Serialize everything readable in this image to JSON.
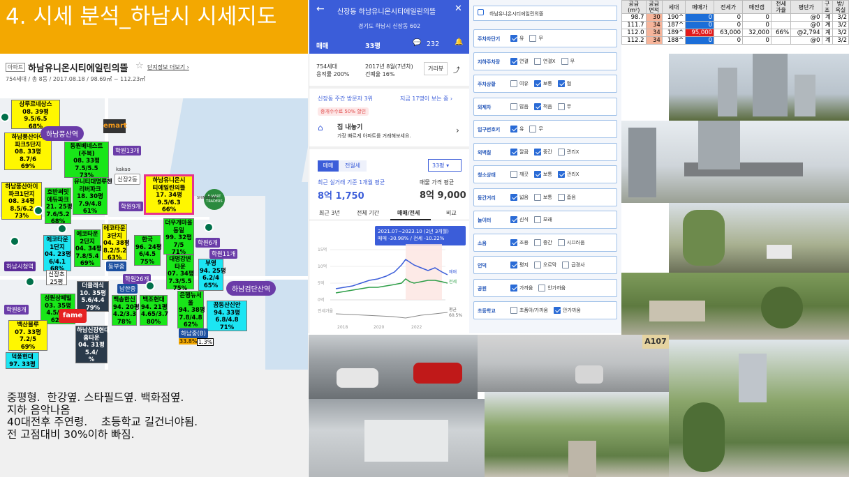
{
  "slide": {
    "title": "4. 시세 분석_하남시 시세지도"
  },
  "complex": {
    "badge": "아파트",
    "name": "하남유니온시티에일린의뜰",
    "link": "단지정보 더보기 ›",
    "meta": "754세대 / 총 8동 / 2017.08.18 / 98.69㎡ ~ 112.23㎡"
  },
  "map": {
    "places": [
      {
        "id": "p1",
        "text": "상루르네상스\n08. 39평\n9.5/6.5\n68%",
        "cls": "yel"
      },
      {
        "id": "p2",
        "text": "하남풍산아이\n파크5단지\n08. 33평\n8.7/6\n69%",
        "cls": "yel"
      },
      {
        "id": "p3",
        "text": "동원베네스트\n(주복)\n08. 33평\n7.5/5.5\n73%",
        "cls": "grn"
      },
      {
        "id": "p4",
        "text": "하남풍산아이\n파크1단지\n08. 34평\n8.5/6.2\n73%",
        "cls": "yel"
      },
      {
        "id": "p5",
        "text": "호반써밋\n에듀파크\n21. 25평\n7.6/5.2\n68%",
        "cls": "grn"
      },
      {
        "id": "p6",
        "text": "유니티대명루첸\n리버파크\n18. 30평\n7.9/4.8\n61%",
        "cls": "grn"
      },
      {
        "id": "p7",
        "text": "하남유니온시\n티에일린의뜰\n17. 34평\n9.5/6.3\n66%",
        "cls": "yel"
      },
      {
        "id": "p8",
        "text": "에코타운\n1단지\n04. 23평\n6/4.1\n68%",
        "cls": "cyn"
      },
      {
        "id": "p9",
        "text": "에코타운\n2단지\n04. 34평\n7.8/5.4\n69%",
        "cls": "grn"
      },
      {
        "id": "p10",
        "text": "에코타운\n3단지\n04. 38평\n8.2/5.2\n63%",
        "cls": "yel"
      },
      {
        "id": "p11",
        "text": "한국\n96. 24평\n6/4.5\n75%",
        "cls": "grn"
      },
      {
        "id": "p12",
        "text": "더우개마을\n동일\n99. 32평\n7/5\n71%",
        "cls": "grn"
      },
      {
        "id": "p13",
        "text": "대명강변\n타운\n07. 34평\n7.3/5.5\n75%",
        "cls": "grn"
      },
      {
        "id": "p14",
        "text": "부영\n94. 25평\n6.2/4\n65%",
        "cls": "cyn"
      },
      {
        "id": "p15",
        "text": "더클래식\n10. 35평\n5.6/4.4\n79%",
        "cls": "drk"
      },
      {
        "id": "p16",
        "text": "성원상떼빌\n03. 35평\n4.5/2.8\n62%",
        "cls": "grn"
      },
      {
        "id": "p17",
        "text": "백송한신\n94. 20평\n4.2/3.3\n78%",
        "cls": "grn"
      },
      {
        "id": "p18",
        "text": "백조현대\n94. 21평\n4.65/3.7\n80%",
        "cls": "grn"
      },
      {
        "id": "p19",
        "text": "은행뉴서\n울\n94. 38평\n7.8/4.8\n62%",
        "cls": "grn"
      },
      {
        "id": "p20",
        "text": "꿈동산신안\n94. 33평\n6.8/4.8\n71%",
        "cls": "cyn"
      },
      {
        "id": "p21",
        "text": "백산블루\n07. 33평\n7.2/5\n69%",
        "cls": "yel"
      },
      {
        "id": "p22",
        "text": "하남신장현대\n홈타운\n04. 31평\n5.4/\n%",
        "cls": "drk"
      },
      {
        "id": "p23",
        "text": "덕풍현대\n97. 33평",
        "cls": "cyn"
      }
    ],
    "labels": [
      {
        "id": "l1",
        "text": "학원13개"
      },
      {
        "id": "l2",
        "text": "학원9개"
      },
      {
        "id": "l3",
        "text": "학원6개"
      },
      {
        "id": "l4",
        "text": "학원11개"
      },
      {
        "id": "l5",
        "text": "학원26개"
      },
      {
        "id": "l6",
        "text": "학원8개"
      },
      {
        "id": "l7",
        "text": "하남시청역"
      },
      {
        "id": "l8",
        "text": "신장2동"
      },
      {
        "id": "l9",
        "text": "남한중"
      },
      {
        "id": "l10",
        "text": "하남중(B)"
      }
    ],
    "stations": {
      "s1": "하남풍산역",
      "s2": "하남검단산역"
    },
    "stores": {
      "emart": "emart",
      "traders": "E-MART TRADERS",
      "kakao": "kakao",
      "shinsegae": "SHINSEGAE"
    },
    "misc": {
      "dongbu": "동부중",
      "sinjang": "신장초\n25평",
      "ratio1": "33.8%",
      "ratio2": "1.3%"
    }
  },
  "notes": "중평형.  한강옆. 스타필드옆. 백화점옆.\n지하 음악나옴\n40대전후 주연령.    초등학교 길건너야됨.\n전 고점대비 30%이하 빠짐.",
  "mobile": {
    "header_title": "신장동 하남유니온시티에일린의뜰",
    "header_sub": "경기도 하남시 신장동 602",
    "tab_trade": "매매",
    "tab_size": "33평",
    "comment_count": "232",
    "stats": {
      "households": "754세대",
      "floor_area": "용적률 200%",
      "built": "2017년 8월(7년차)",
      "building_coverage": "건폐율 16%",
      "roadview": "거리뷰"
    },
    "visitors": "신장동 주간 방문자 3위",
    "visitors_link": "지금 17명이 보는 중 ›",
    "promo_badge": "중개수수료 50% 할인",
    "promo_title": "집 내놓기",
    "promo_desc": "가장 빠르게 아파트를 거래해보세요.",
    "seg_sale": "매매",
    "seg_rent": "전월세",
    "size_select": "33평",
    "recent_label": "최근 실거래 기준 1개월 평균",
    "recent_value": "8억 1,750",
    "asking_label": "매물 가격 평균",
    "asking_value": "8억 9,000",
    "chart_tabs": [
      "최근 3년",
      "전체 기간",
      "매매/전세",
      "비교"
    ],
    "chart_tooltip_1": "2021.07~2023.10 (2년 3개월)",
    "chart_tooltip_2": "매매 -30.98%  /  전세 -10.22%",
    "y_ticks": [
      "15억",
      "10억",
      "5억",
      "0억"
    ],
    "x_ticks": [
      "2018",
      "2020",
      "2022"
    ],
    "right_labels": {
      "sale": "매매",
      "jeonse": "전세",
      "avg": "평균",
      "avg_val": "60.5%"
    },
    "ratio_label": "전세가율"
  },
  "checklist": {
    "search": "하남유니온시티에일린의뜰",
    "rows": [
      {
        "label": "주차차단기",
        "opts": [
          [
            "유",
            true
          ],
          [
            "무",
            false
          ]
        ]
      },
      {
        "label": "지하주차장",
        "opts": [
          [
            "연결",
            true
          ],
          [
            "연결X",
            false
          ],
          [
            "무",
            false
          ]
        ]
      },
      {
        "label": "주차상황",
        "opts": [
          [
            "여유",
            false
          ],
          [
            "보통",
            true
          ],
          [
            "협",
            true
          ]
        ]
      },
      {
        "label": "외제차",
        "opts": [
          [
            "많음",
            false
          ],
          [
            "적음",
            true
          ],
          [
            "무",
            false
          ]
        ]
      },
      {
        "label": "입구번호키",
        "opts": [
          [
            "유",
            true
          ],
          [
            "무",
            false
          ]
        ]
      },
      {
        "label": "외벽칠",
        "opts": [
          [
            "깔끔",
            true
          ],
          [
            "중간",
            true
          ],
          [
            "관리X",
            false
          ]
        ]
      },
      {
        "label": "청소상태",
        "opts": [
          [
            "깨끗",
            false
          ],
          [
            "보통",
            true
          ],
          [
            "관리X",
            true
          ]
        ]
      },
      {
        "label": "동간거리",
        "opts": [
          [
            "넓음",
            true
          ],
          [
            "보통",
            false
          ],
          [
            "좁음",
            false
          ]
        ]
      },
      {
        "label": "놀이터",
        "opts": [
          [
            "신식",
            true
          ],
          [
            "모래",
            false
          ]
        ]
      },
      {
        "label": "소음",
        "opts": [
          [
            "조용",
            true
          ],
          [
            "중간",
            false
          ],
          [
            "시끄러움",
            false
          ]
        ]
      },
      {
        "label": "언덕",
        "opts": [
          [
            "평지",
            true
          ],
          [
            "오르막",
            false
          ],
          [
            "급경사",
            false
          ]
        ]
      },
      {
        "label": "공원",
        "opts": [
          [
            "가까움",
            true
          ],
          [
            "안가까움",
            false
          ]
        ]
      },
      {
        "label": "초등학교",
        "opts": [
          [
            "초품아/가까움",
            false
          ],
          [
            "안가까움",
            true
          ]
        ]
      }
    ]
  },
  "table": {
    "headers": [
      "공급\n(m²)",
      "공급\n면적",
      "세대",
      "매매가",
      "전세가",
      "매전갭",
      "전세\n가율",
      "평단가",
      "구\n조",
      "방/\n욕실"
    ],
    "rows": [
      [
        "98.7",
        "30",
        "190^",
        "0",
        "0",
        "0",
        "",
        "@0",
        "계",
        "3/2"
      ],
      [
        "111.7",
        "34",
        "187^",
        "0",
        "0",
        "0",
        "",
        "@0",
        "계",
        "3/2"
      ],
      [
        "112.0",
        "34",
        "189^",
        "95,000",
        "63,000",
        "32,000",
        "66%",
        "@2,794",
        "계",
        "3/2"
      ],
      [
        "112.2",
        "34",
        "188^",
        "0",
        "0",
        "0",
        "",
        "@0",
        "계",
        "3/2"
      ]
    ]
  },
  "photos": {
    "sign": "A107"
  },
  "colors": {
    "title_bg": "#F3A801",
    "mobile_blue": "#3b5dd9",
    "sale_line": "#3b5dd9",
    "jeonse_line": "#2e9e48"
  }
}
